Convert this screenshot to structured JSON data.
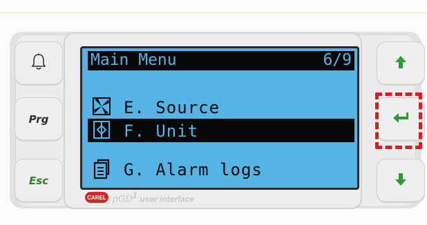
{
  "screen": {
    "title": "Main Menu",
    "page": "6/9",
    "items": [
      {
        "label": "E. Source",
        "icon": "fan-icon",
        "selected": false
      },
      {
        "label": "F. Unit",
        "icon": "unit-icon",
        "selected": true
      },
      {
        "label": "G. Alarm logs",
        "icon": "document-icon",
        "selected": false
      }
    ]
  },
  "buttons": {
    "prg": "Prg",
    "esc": "Esc",
    "alarm_icon": "bell-icon",
    "up_icon": "arrow-up-icon",
    "enter_icon": "enter-icon",
    "down_icon": "arrow-down-icon"
  },
  "branding": {
    "logo_text": "CAREL",
    "product_prefix": "pGD",
    "product_sup": "1",
    "product_suffix": "user interface"
  },
  "colors": {
    "lcd_background": "#56b3e6",
    "highlight_dashes": "#d42020",
    "arrow_green": "#2f9a3b"
  }
}
